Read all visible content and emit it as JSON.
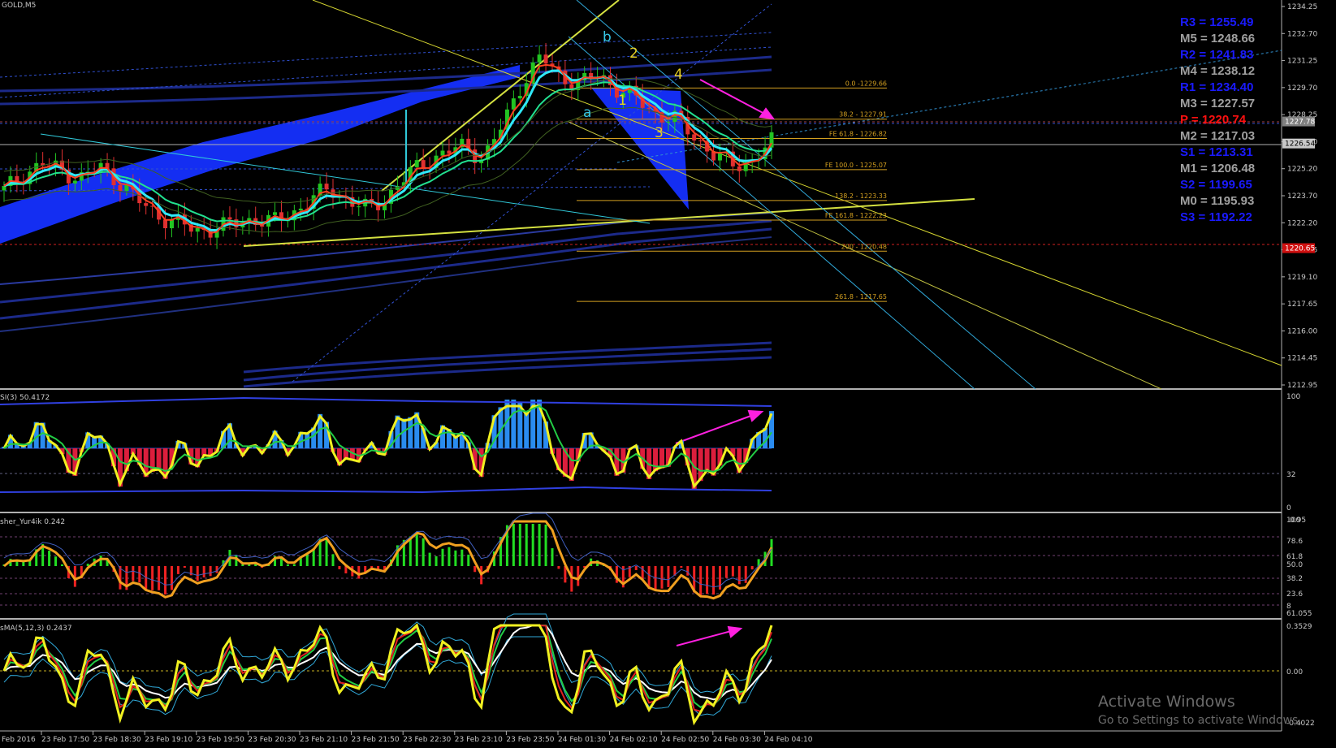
{
  "symbol": "GOLD,M5",
  "panels": {
    "rsi": {
      "title": "SI(3) 50.4172",
      "levels": [
        "100",
        "32",
        "0"
      ]
    },
    "fisher": {
      "title": "sher_Yur4ik 0.242",
      "levels": [
        "100",
        "78.6",
        "61.8",
        "50.0",
        "38.2",
        "23.6",
        "8",
        "61.055"
      ],
      "top_overlap": "0.95"
    },
    "osma": {
      "title": "sMA(5,12,3) 0.2437",
      "levels": [
        "0.3529",
        "0.00",
        "-0.4022"
      ]
    }
  },
  "price_axis": [
    "1234.25",
    "1232.70",
    "1231.25",
    "1229.70",
    "1228.25",
    "1226.70",
    "1225.20",
    "1223.70",
    "1222.20",
    "1220.65",
    "1219.10",
    "1217.65",
    "1216.00",
    "1214.45",
    "1212.95"
  ],
  "price_tags": [
    {
      "value": "1227.78",
      "kind": "ask"
    },
    {
      "value": "1226.54",
      "kind": "bid"
    },
    {
      "value": "1220.65",
      "kind": "red"
    }
  ],
  "time_axis": [
    "Feb 2016",
    "23 Feb 17:50",
    "23 Feb 18:30",
    "23 Feb 19:10",
    "23 Feb 19:50",
    "23 Feb 20:30",
    "23 Feb 21:10",
    "23 Feb 21:50",
    "23 Feb 22:30",
    "23 Feb 23:10",
    "23 Feb 23:50",
    "24 Feb 01:30",
    "24 Feb 02:10",
    "24 Feb 02:50",
    "24 Feb 03:30",
    "24 Feb 04:10"
  ],
  "fib_levels": [
    {
      "label": "0.0 -1229.66",
      "price": 1229.66
    },
    {
      "label": "38.2 - 1227.91",
      "price": 1227.91
    },
    {
      "label": "FE 61.8 - 1226.82",
      "price": 1226.82
    },
    {
      "label": "FE 100.0 - 1225.07",
      "price": 1225.07
    },
    {
      "label": "138.2 - 1223.33",
      "price": 1223.33
    },
    {
      "label": "FE 161.8 - 1222.23",
      "price": 1222.23
    },
    {
      "label": "200 - 1220.48",
      "price": 1220.48
    },
    {
      "label": "261.8 - 1217.65",
      "price": 1217.65
    }
  ],
  "pivots": [
    {
      "label": "R3 = 1255.49",
      "color": "#1a1aff"
    },
    {
      "label": "M5 = 1248.66",
      "color": "#a0a0a0"
    },
    {
      "label": "R2 = 1241.83",
      "color": "#1a1aff"
    },
    {
      "label": "M4 = 1238.12",
      "color": "#a0a0a0"
    },
    {
      "label": "R1 = 1234.40",
      "color": "#1a1aff"
    },
    {
      "label": "M3 = 1227.57",
      "color": "#a0a0a0"
    },
    {
      "label": "P   = 1220.74",
      "color": "#ff1010"
    },
    {
      "label": "M2 = 1217.03",
      "color": "#a0a0a0"
    },
    {
      "label": "S1 = 1213.31",
      "color": "#1a1aff"
    },
    {
      "label": "M1 = 1206.48",
      "color": "#a0a0a0"
    },
    {
      "label": "S2 = 1199.65",
      "color": "#1a1aff"
    },
    {
      "label": "M0 = 1195.93",
      "color": "#a0a0a0"
    },
    {
      "label": "S3 = 1192.22",
      "color": "#1a1aff"
    }
  ],
  "wave_labels": [
    {
      "text": "b",
      "color": "#38c8e8"
    },
    {
      "text": "a",
      "color": "#38c8e8"
    },
    {
      "text": "2",
      "color": "#e8d020"
    },
    {
      "text": "1",
      "color": "#e8d020"
    },
    {
      "text": "4",
      "color": "#e8d020"
    },
    {
      "text": "3",
      "color": "#e8d020"
    }
  ],
  "watermark": {
    "line1": "Activate Windows",
    "line2": "Go to Settings to activate Windows."
  },
  "colors": {
    "bull": "#22c422",
    "bear": "#e03030",
    "hist_up": "#2a8cf0",
    "hist_down": "#dc1e3c",
    "fisher_up": "#22dd22",
    "fisher_down": "#ee2222",
    "fib": "#d4a020",
    "arrow": "#ff20e0"
  },
  "chart_data": {
    "type": "candlestick",
    "symbol": "GOLD",
    "timeframe": "M5",
    "ylim": [
      1212.95,
      1234.25
    ],
    "close_samples": [
      1223.9,
      1224.8,
      1225.4,
      1225.0,
      1224.6,
      1225.2,
      1224.4,
      1223.3,
      1222.5,
      1222.1,
      1221.6,
      1221.8,
      1222.0,
      1222.3,
      1222.1,
      1222.6,
      1223.4,
      1224.0,
      1223.3,
      1222.8,
      1223.6,
      1224.7,
      1225.6,
      1226.0,
      1226.4,
      1225.7,
      1227.6,
      1230.0,
      1231.4,
      1230.3,
      1229.9,
      1230.4,
      1229.6,
      1229.0,
      1228.2,
      1227.9,
      1226.9,
      1225.9,
      1225.3,
      1225.6,
      1226.6
    ],
    "last_bid": 1226.54,
    "last_ask": 1227.78,
    "support_line": 1220.65
  }
}
